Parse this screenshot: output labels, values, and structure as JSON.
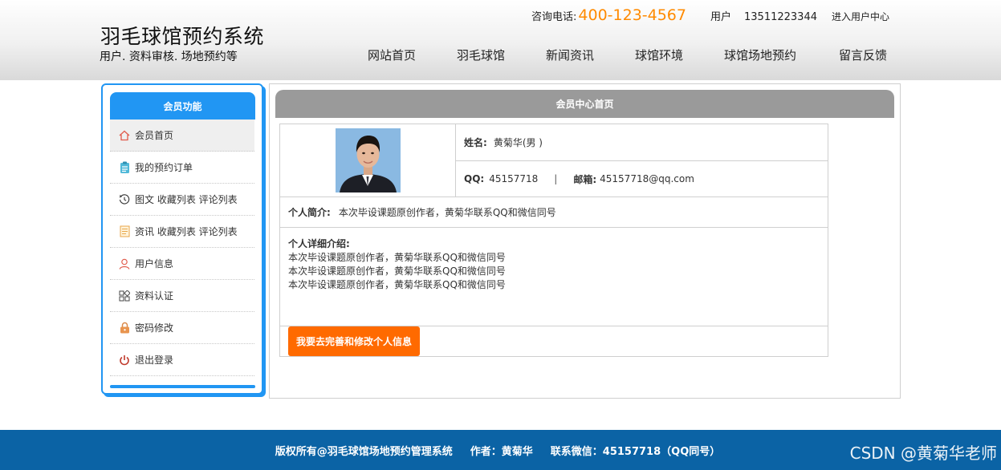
{
  "header": {
    "title": "羽毛球馆预约系统",
    "subtitle": "用户. 资料审核. 场地预约等",
    "contact_label": "咨询电话:",
    "phone": "400-123-4567",
    "user_label": "用户",
    "user_value": "13511223344",
    "center_link": "进入用户中心"
  },
  "nav": [
    "网站首页",
    "羽毛球馆",
    "新闻资讯",
    "球馆环境",
    "球馆场地预约",
    "留言反馈"
  ],
  "sidebar": {
    "title": "会员功能",
    "items": [
      {
        "label": "会员首页",
        "icon": "home-icon"
      },
      {
        "label": "我的预约订单",
        "icon": "clipboard-icon"
      },
      {
        "label": "图文 收藏列表 评论列表",
        "icon": "history-icon"
      },
      {
        "label": "资讯 收藏列表 评论列表",
        "icon": "document-icon"
      },
      {
        "label": "用户信息",
        "icon": "user-icon"
      },
      {
        "label": "资料认证",
        "icon": "apps-icon"
      },
      {
        "label": "密码修改",
        "icon": "lock-icon"
      },
      {
        "label": "退出登录",
        "icon": "power-icon"
      }
    ]
  },
  "main": {
    "title": "会员中心首页",
    "name_label": "姓名:",
    "name_value": "黄菊华(男 )",
    "qq_label": "QQ:",
    "qq_value": "45157718",
    "separator": "|",
    "email_label": "邮箱:",
    "email_value": "45157718@qq.com",
    "intro_label": "个人简介:",
    "intro_value": "本次毕设课题原创作者，黄菊华联系QQ和微信同号",
    "detail_label": "个人详细介绍:",
    "detail_lines": [
      "本次毕设课题原创作者，黄菊华联系QQ和微信同号",
      "本次毕设课题原创作者，黄菊华联系QQ和微信同号",
      "本次毕设课题原创作者，黄菊华联系QQ和微信同号"
    ],
    "edit_button": "我要去完善和修改个人信息"
  },
  "footer": {
    "copyright": "版权所有@羽毛球馆场地预约管理系统",
    "author": "作者：黄菊华",
    "wechat": "联系微信：45157718（QQ同号）"
  },
  "watermark": "CSDN @黄菊华老师",
  "colors": {
    "accent_blue": "#2196f3",
    "phone_orange": "#ff8a00",
    "button_orange": "#ff6a00",
    "footer_blue": "#0b63a5",
    "panel_head_gray": "#9a9a9a"
  }
}
